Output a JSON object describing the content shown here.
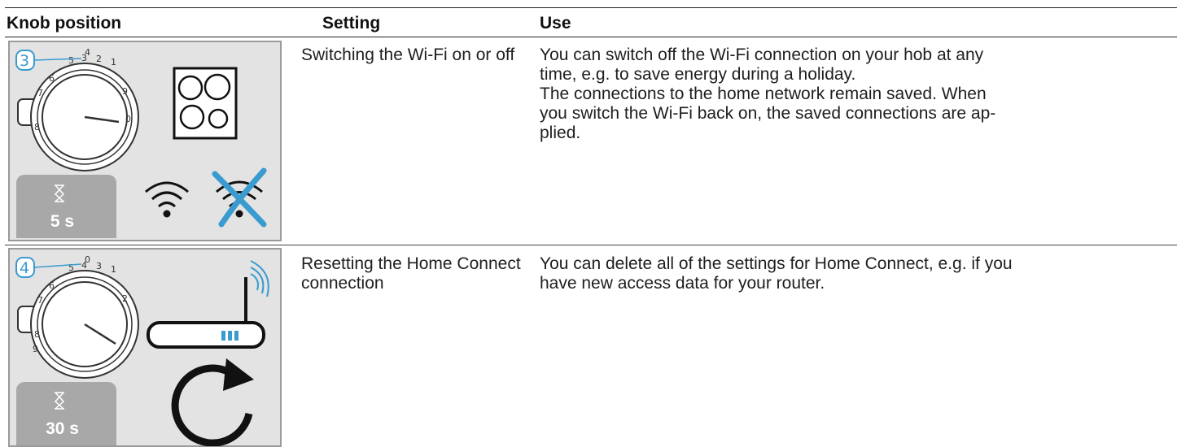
{
  "header": {
    "knob_position": "Knob position",
    "setting": "Setting",
    "use": "Use"
  },
  "rows": [
    {
      "knob_number": "3",
      "dial_numbers": [
        "0",
        "1",
        "2",
        "3",
        "4",
        "5",
        "6",
        "7",
        "8",
        "9"
      ],
      "timer": "5 s",
      "setting": "Switching the Wi-Fi on or off",
      "use_lines": [
        "You can switch off the Wi-Fi connection on your hob at any",
        "time, e.g. to save energy during a holiday.",
        "The connections to the home network remain saved. When",
        "you switch the Wi-Fi back on, the saved connections are ap-",
        "plied."
      ],
      "icons": [
        "hob-icon",
        "wifi-on-icon",
        "wifi-off-icon",
        "hourglass-icon"
      ]
    },
    {
      "knob_number": "4",
      "dial_numbers": [
        "0",
        "1",
        "2",
        "3",
        "4",
        "5",
        "6",
        "7",
        "8",
        "9"
      ],
      "timer": "30 s",
      "setting": "Resetting the Home Connect connection",
      "use_lines": [
        "You can delete all of the settings for Home Connect, e.g. if you",
        "have new access data for your router."
      ],
      "icons": [
        "router-icon",
        "reset-arrow-icon",
        "hourglass-icon"
      ]
    }
  ],
  "colors": {
    "accent_blue": "#3a9bd0",
    "panel_gray": "#e3e3e3",
    "timer_gray": "#a8a8a8"
  }
}
